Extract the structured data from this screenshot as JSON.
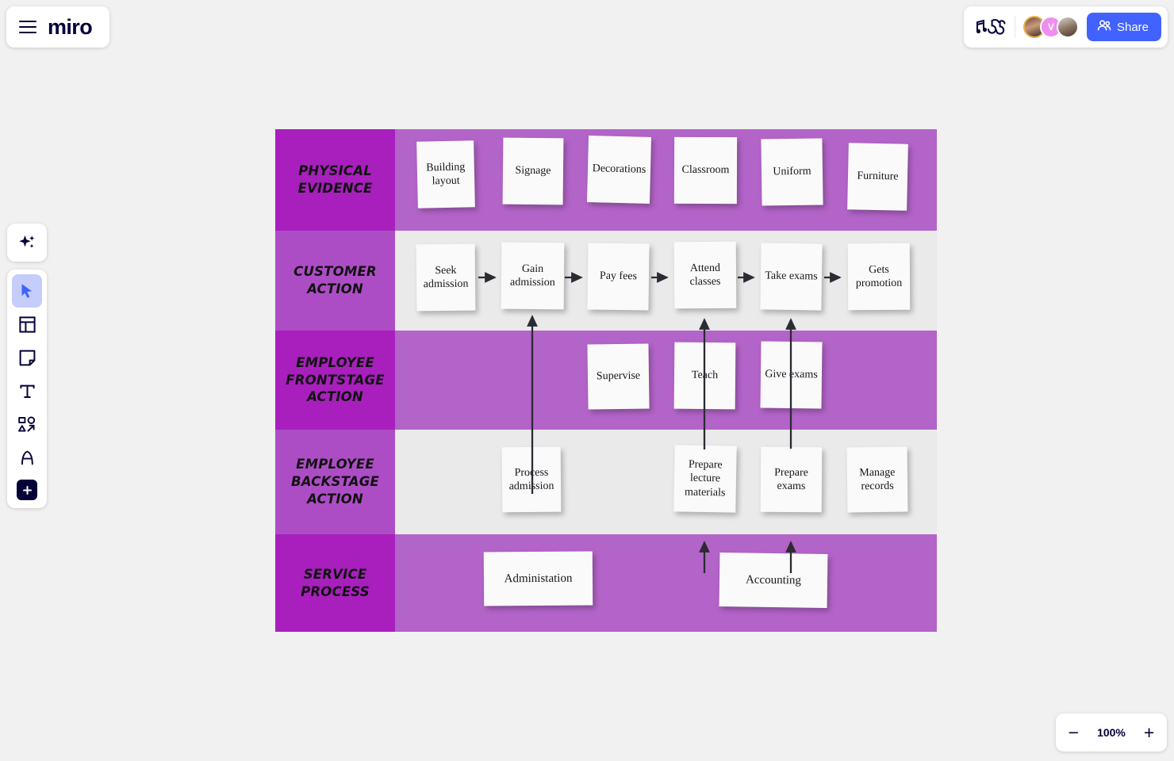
{
  "app": {
    "brand": "miro",
    "menu_icon": "hamburger-icon"
  },
  "topbar": {
    "notes_icon": "music-notes-icon",
    "share_label": "Share",
    "share_icon": "people-icon",
    "share_color": "#4262ff",
    "avatars": [
      {
        "name": "collaborator-1",
        "initial": ""
      },
      {
        "name": "collaborator-2",
        "initial": "V"
      },
      {
        "name": "collaborator-3",
        "initial": ""
      }
    ]
  },
  "toolbar": {
    "ai": {
      "label": "AI",
      "icon": "sparkle-icon"
    },
    "items": [
      {
        "name": "select-tool",
        "icon": "cursor-icon",
        "active": true
      },
      {
        "name": "frame-tool",
        "icon": "frame-icon",
        "active": false
      },
      {
        "name": "sticky-note-tool",
        "icon": "sticky-note-icon",
        "active": false
      },
      {
        "name": "text-tool",
        "icon": "text-icon",
        "active": false
      },
      {
        "name": "shapes-tool",
        "icon": "shapes-icon",
        "active": false
      },
      {
        "name": "pen-tool",
        "icon": "pen-icon",
        "active": false
      },
      {
        "name": "more-apps",
        "icon": "plus-icon",
        "active": false
      }
    ]
  },
  "zoom": {
    "minus_label": "−",
    "value": "100%",
    "plus_label": "+"
  },
  "blueprint": {
    "rows": [
      {
        "name": "physical-evidence",
        "label_line1": "Physical",
        "label_line2": "Evidence",
        "label_line3": "",
        "tone": "dark",
        "notes": [
          "Building layout",
          "Signage",
          "Decorations",
          "Classroom",
          "Uniform",
          "Furniture"
        ]
      },
      {
        "name": "customer-action",
        "label_line1": "Customer",
        "label_line2": "Action",
        "label_line3": "",
        "tone": "light",
        "notes": [
          "Seek admission",
          "Gain admission",
          "Pay fees",
          "Attend classes",
          "Take exams",
          "Gets promotion"
        ]
      },
      {
        "name": "employee-frontstage-action",
        "label_line1": "Employee",
        "label_line2": "Frontstage",
        "label_line3": "Action",
        "tone": "dark",
        "notes": [
          "Supervise",
          "Teach",
          "Give exams"
        ]
      },
      {
        "name": "employee-backstage-action",
        "label_line1": "Employee",
        "label_line2": "Backstage",
        "label_line3": "Action",
        "tone": "light",
        "notes": [
          "Process admission",
          "Prepare lecture materials",
          "Prepare exams",
          "Manage records"
        ]
      },
      {
        "name": "service-process",
        "label_line1": "Service",
        "label_line2": "Process",
        "label_line3": "",
        "tone": "dark",
        "notes": [
          "Administation",
          "Accounting"
        ]
      }
    ],
    "colors": {
      "label_dark": "#a81fbd",
      "label_light": "#ad4dc5",
      "lane_purple": "#b364c8",
      "lane_gray": "#eaeaea",
      "note": "#fafafa"
    }
  }
}
